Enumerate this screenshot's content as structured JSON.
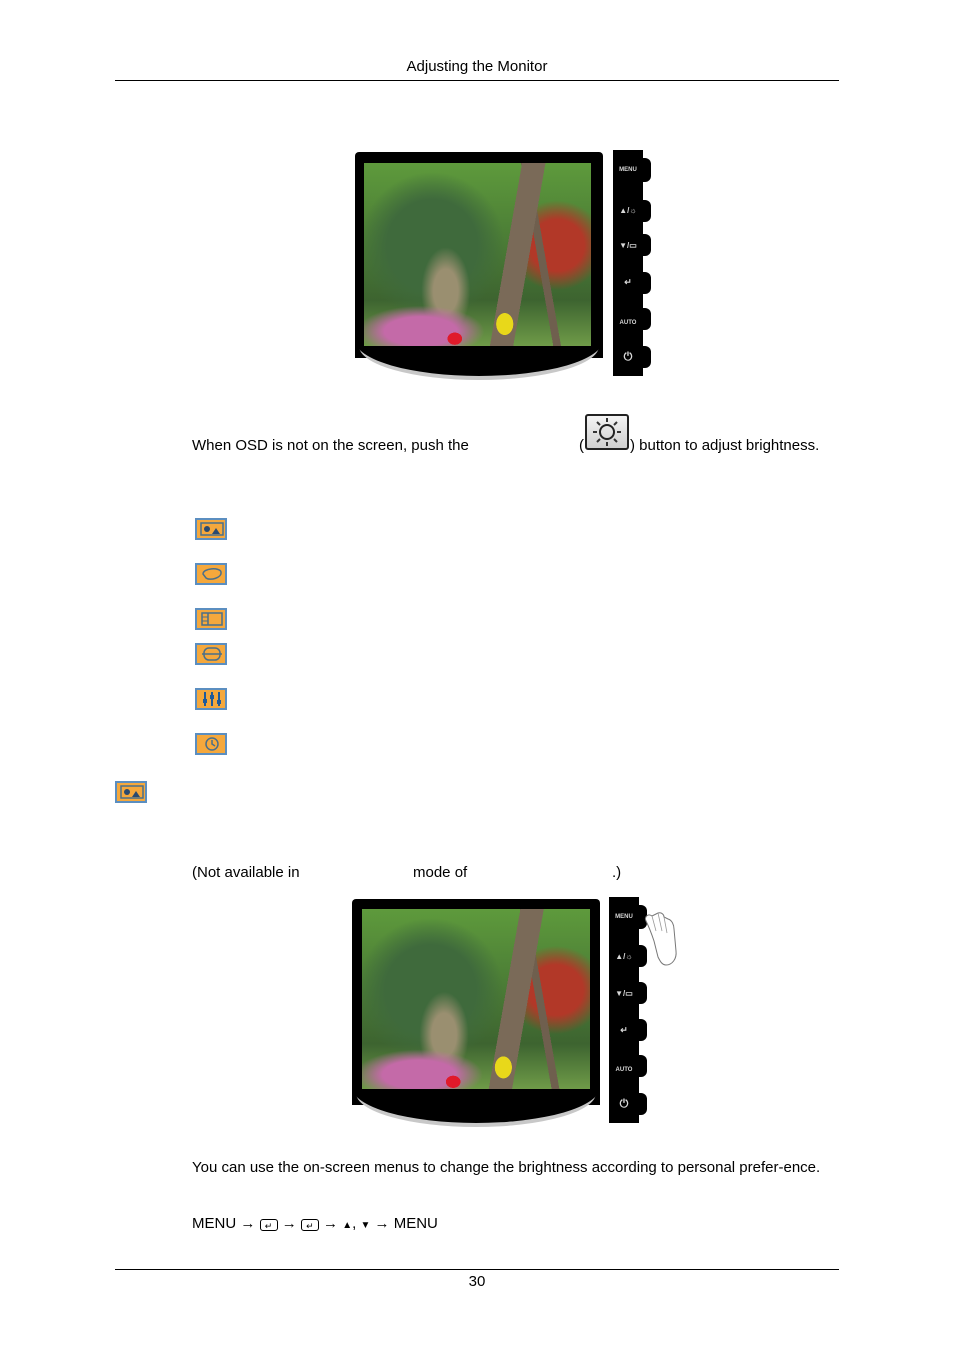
{
  "header": {
    "title": "Adjusting the Monitor"
  },
  "monitor_panel_buttons": [
    {
      "id": "menu",
      "label": "MENU"
    },
    {
      "id": "up-brightness",
      "label": "▲/☼"
    },
    {
      "id": "down-magic",
      "label": "▼/▭"
    },
    {
      "id": "enter",
      "label": "↵"
    },
    {
      "id": "auto",
      "label": "AUTO"
    },
    {
      "id": "power",
      "label": "⏻"
    }
  ],
  "brightness_instruction": {
    "prefix": "When OSD is not on the screen, push the",
    "open_paren": "(",
    "suffix": ") button to adjust brightness.",
    "button_icon": "sun-brightness-icon"
  },
  "osd_menu_icons": [
    {
      "name": "picture-icon"
    },
    {
      "name": "color-icon"
    },
    {
      "name": "image-icon"
    },
    {
      "name": "osd-icon"
    },
    {
      "name": "setup-icon"
    },
    {
      "name": "information-icon"
    }
  ],
  "section_icon": {
    "name": "picture-icon"
  },
  "not_available_note": {
    "part1": "(Not available in",
    "part2": "mode of",
    "part3": ".)"
  },
  "description": "You can use the on-screen menus to change the brightness according to personal prefer-ence.",
  "navigation_path": {
    "start": "MENU",
    "arrow": "→",
    "enter_glyph": "↵",
    "up": "▲",
    "separator": ",",
    "down": "▼",
    "end": "MENU"
  },
  "footer": {
    "page_number": "30"
  },
  "colors": {
    "icon_fill": "#f5a83c",
    "icon_border": "#5b8ec0",
    "bezel": "#000000"
  }
}
